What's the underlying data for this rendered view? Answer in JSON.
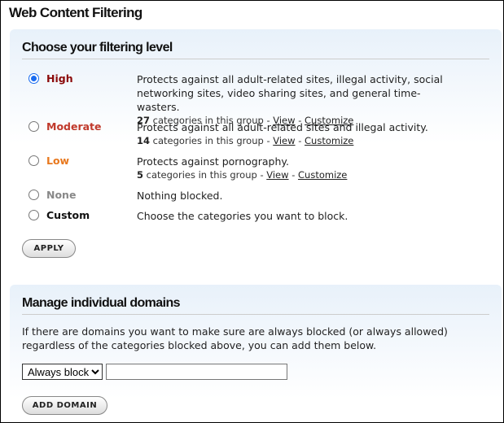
{
  "title": "Web Content Filtering",
  "filtering": {
    "heading": "Choose your filtering level",
    "levels": [
      {
        "label": "High",
        "color": "#8b0a0a",
        "selected": true,
        "desc": "Protects against all adult-related sites, illegal activity, social networking sites, video sharing sites, and general time-wasters.",
        "count": "27",
        "count_text": "categories in this group -",
        "view": "View",
        "sep": "-",
        "customize": "Customize"
      },
      {
        "label": "Moderate",
        "color": "#c0392b",
        "selected": false,
        "desc": "Protects against all adult-related sites and illegal activity.",
        "count": "14",
        "count_text": "categories in this group -",
        "view": "View",
        "sep": "-",
        "customize": "Customize"
      },
      {
        "label": "Low",
        "color": "#e8781e",
        "selected": false,
        "desc": "Protects against pornography.",
        "count": "5",
        "count_text": "categories in this group -",
        "view": "View",
        "sep": "-",
        "customize": "Customize"
      },
      {
        "label": "None",
        "color": "#888888",
        "selected": false,
        "desc": "Nothing blocked."
      },
      {
        "label": "Custom",
        "color": "#111111",
        "selected": false,
        "desc": "Choose the categories you want to block."
      }
    ],
    "apply_label": "APPLY"
  },
  "domains": {
    "heading": "Manage individual domains",
    "text": "If there are domains you want to make sure are always blocked (or always allowed) regardless of the categories blocked above, you can add them below.",
    "select_value": "Always block",
    "input_value": "",
    "add_label": "ADD DOMAIN"
  }
}
